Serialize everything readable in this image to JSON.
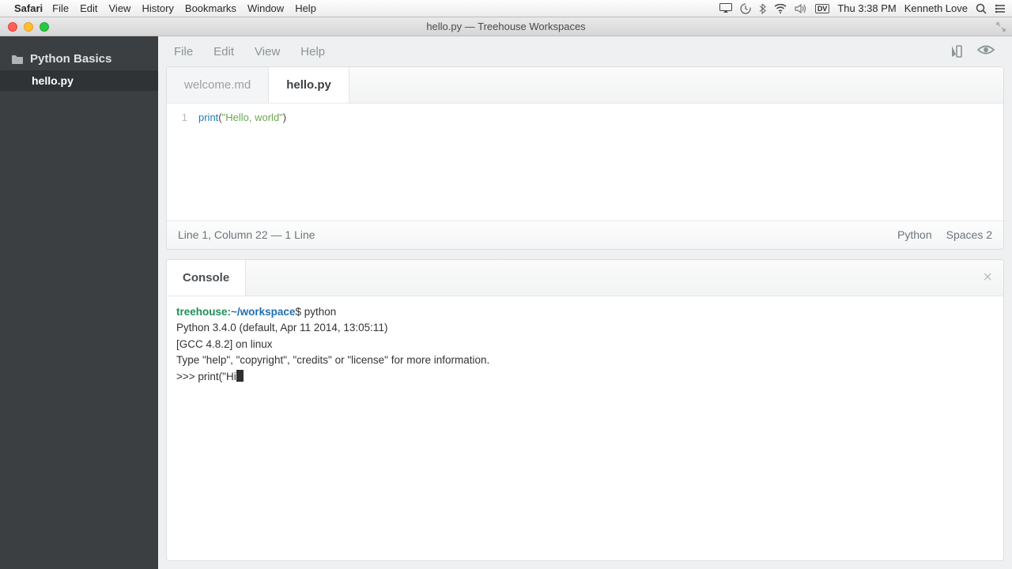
{
  "mac": {
    "app_name": "Safari",
    "menus": [
      "File",
      "Edit",
      "View",
      "History",
      "Bookmarks",
      "Window",
      "Help"
    ],
    "clock": "Thu 3:38 PM",
    "user": "Kenneth Love",
    "dv_badge": "DV"
  },
  "window": {
    "title": "hello.py — Treehouse Workspaces"
  },
  "sidebar": {
    "project": "Python Basics",
    "file": "hello.py"
  },
  "app_menu": {
    "items": [
      "File",
      "Edit",
      "View",
      "Help"
    ]
  },
  "tabs": {
    "inactive": "welcome.md",
    "active": "hello.py"
  },
  "editor": {
    "line_num": "1",
    "fn": "print",
    "open": "(",
    "str": "\"Hello, world\"",
    "close": ")"
  },
  "status": {
    "left": "Line 1, Column 22 — 1 Line",
    "lang": "Python",
    "indent": "Spaces  2"
  },
  "console": {
    "tab": "Console",
    "host": "treehouse:",
    "path": "~/workspace",
    "prompt_suffix": "$ ",
    "cmd": "python",
    "line1": "Python 3.4.0 (default, Apr 11 2014, 13:05:11)",
    "line2": "[GCC 4.8.2] on linux",
    "line3": "Type \"help\", \"copyright\", \"credits\" or \"license\" for more information.",
    "repl_prompt": ">>> ",
    "repl_input": "print(\"Hi"
  }
}
